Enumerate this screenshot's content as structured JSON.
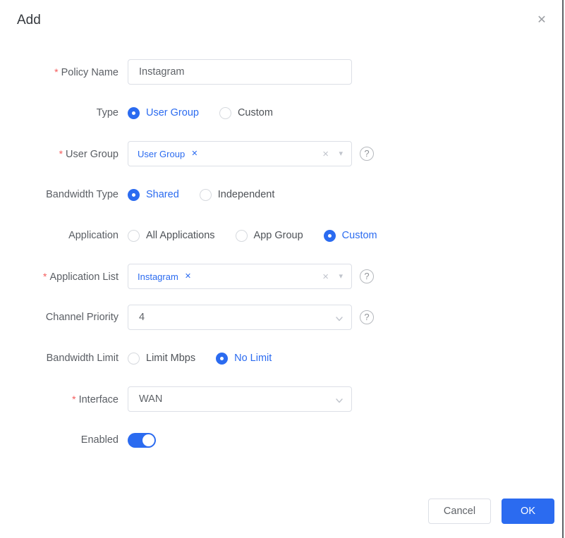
{
  "accent_color": "#2b6bf0",
  "required_color": "#f45b5b",
  "edge_line_color": "#5c6266",
  "dialog": {
    "title": "Add"
  },
  "icons": {
    "close": "✕",
    "clear": "×",
    "caret_down": "▾",
    "help": "?",
    "tag_close": "✕"
  },
  "required_marker": "*",
  "fields": {
    "policy_name": {
      "label": "Policy Name",
      "required": true,
      "value": "Instagram"
    },
    "type": {
      "label": "Type",
      "options": [
        {
          "label": "User Group",
          "selected": true
        },
        {
          "label": "Custom",
          "selected": false
        }
      ]
    },
    "user_group": {
      "label": "User Group",
      "required": true,
      "tag": "User Group"
    },
    "bandwidth_type": {
      "label": "Bandwidth Type",
      "options": [
        {
          "label": "Shared",
          "selected": true
        },
        {
          "label": "Independent",
          "selected": false
        }
      ]
    },
    "application": {
      "label": "Application",
      "options": [
        {
          "label": "All Applications",
          "selected": false
        },
        {
          "label": "App Group",
          "selected": false
        },
        {
          "label": "Custom",
          "selected": true
        }
      ]
    },
    "application_list": {
      "label": "Application List",
      "required": true,
      "tag": "Instagram"
    },
    "channel_priority": {
      "label": "Channel Priority",
      "value": "4"
    },
    "bandwidth_limit": {
      "label": "Bandwidth Limit",
      "options": [
        {
          "label": "Limit Mbps",
          "selected": false
        },
        {
          "label": "No Limit",
          "selected": true
        }
      ]
    },
    "interface": {
      "label": "Interface",
      "required": true,
      "value": "WAN"
    },
    "enabled": {
      "label": "Enabled",
      "on": true
    }
  },
  "buttons": {
    "cancel": "Cancel",
    "ok": "OK"
  }
}
